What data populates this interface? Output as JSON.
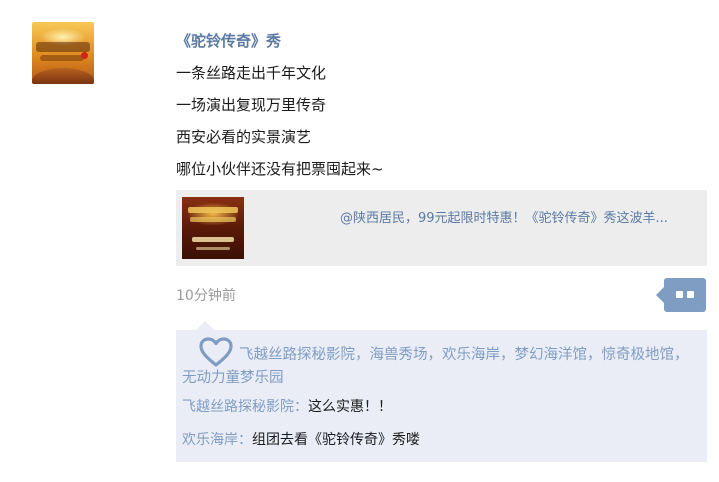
{
  "post": {
    "author": "《驼铃传奇》秀",
    "lines": [
      "一条丝路走出千年文化",
      "一场演出复现万里传奇",
      "西安必看的实景演艺",
      "哪位小伙伴还没有把票囤起来~"
    ],
    "link": {
      "title": "@陕西居民，99元起限时特惠！《驼铃传奇》秀这波羊..."
    },
    "timestamp": "10分钟前"
  },
  "interactions": {
    "likes": "飞越丝路探秘影院，海兽秀场，欢乐海岸，梦幻海洋馆，惊奇极地馆，无动力童梦乐园",
    "comments": [
      {
        "author": "飞越丝路探秘影院",
        "separator": "：",
        "text": "这么实惠！！"
      },
      {
        "author": "欢乐海岸",
        "separator": "：",
        "text": "组团去看《驼铃传奇》秀喽"
      }
    ]
  },
  "icons": {
    "more": "more-actions-icon",
    "like": "heart-icon"
  },
  "colors": {
    "author": "#5b7aa3",
    "accent": "#7f9dc3",
    "card_bg": "#ededed",
    "interaction_bg": "#eaedf5",
    "timestamp": "#9a9a9a"
  }
}
